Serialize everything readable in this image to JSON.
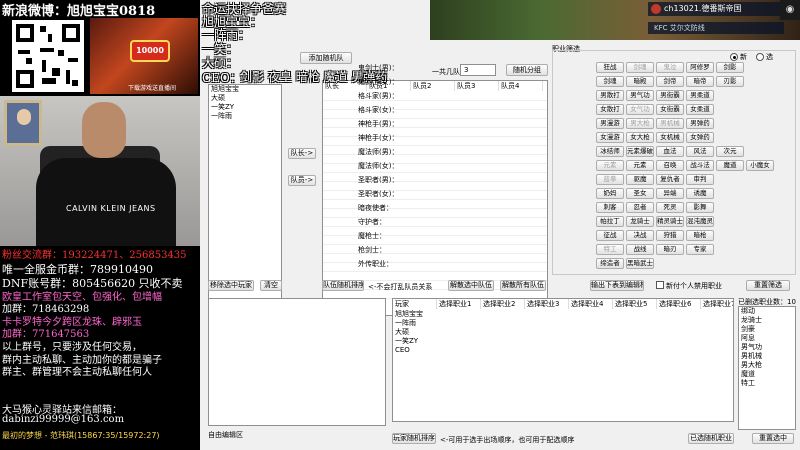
{
  "overlay_left": {
    "weibo": "新浪微博：旭旭宝宝0818",
    "promo_badge": "10000",
    "promo_caption": "下载游戏送直播间",
    "shirt_text": "CALVIN KLEIN JEANS",
    "group_line": "粉丝交流群：193224471、256853435",
    "gold_line": "唯一全服金币群：789910490",
    "dnf_line": "DNF账号群：805456620 只收不卖",
    "eu_line": "欧皇工作室包天空、包强化、包增幅",
    "eu_join": "加群：718463298",
    "card_line": "卡卡罗特今夕跨区龙珠、辟邪玉",
    "card_join": "加群：771647563",
    "warn1": "以上群号，只要涉及任何交易，",
    "warn2": "群内主动私聊、主动加你的都是骗子",
    "warn3": "群主、群管理不会主动私聊任何人",
    "email_label": "大马猴心灵驿站来信邮箱：",
    "email": "dabinzi99999@163.com",
    "stream_status": "最初的梦想 - 范玮琪(15867:35/15972:27)"
  },
  "overlay_titles": {
    "line1": "命运抉择争爸赛",
    "line2": "旭旭宝宝：",
    "line3": "一阵雨：",
    "line4": "一笑：",
    "line5": "大硕：",
    "ceo_label": "CEO：",
    "ceo_classes": "剑影 夜皇  暗枪  魔道  男弹药"
  },
  "game": {
    "player": "ch13021.德番斯帝国",
    "label": "KFC  艾尔文防线",
    "hud": "◉"
  },
  "app": {
    "add_team_button": "添加随机队",
    "team_count_label": "一共几队",
    "team_count_value": "3",
    "random_group_button": "随机分组",
    "players_list": [
      "旭旭宝宝",
      "大硕",
      "一笑ZY",
      "一阵雨"
    ],
    "team_columns": [
      "队长",
      "队员1",
      "队员2",
      "队员3",
      "队员4"
    ],
    "to_captain_button": "队长->",
    "to_member_button": "队员->",
    "move_random_button": "移除选中玩家",
    "clear_button": "清空",
    "team_random_sort_button": "队伍随机排序",
    "team_hint": "<-不会打乱队员关系",
    "dissolve_team_button": "解散选中队伍",
    "dissolve_all_button": "解散所有队伍",
    "job_filter_title": "职业筛选",
    "radio_new": "新",
    "radio_old": "选",
    "job_rows": [
      {
        "label": "鬼剑士(男)：",
        "jobs": [
          "狂战",
          "剑魂",
          "鬼泣",
          "阿修罗",
          "剑影"
        ],
        "disabled": [
          false,
          true,
          true,
          false,
          false
        ]
      },
      {
        "label": "鬼剑士(女)：",
        "jobs": [
          "剑魂",
          "暗殿",
          "剑帝",
          "暗帝",
          "刃影"
        ],
        "disabled": [
          false,
          false,
          false,
          false,
          false
        ]
      },
      {
        "label": "格斗家(男)：",
        "jobs": [
          "男散打",
          "男气功",
          "男街霸",
          "男柔道"
        ],
        "disabled": [
          false,
          false,
          false,
          false
        ]
      },
      {
        "label": "格斗家(女)：",
        "jobs": [
          "女散打",
          "女气功",
          "女街霸",
          "女柔道"
        ],
        "disabled": [
          false,
          true,
          false,
          false
        ]
      },
      {
        "label": "神枪手(男)：",
        "jobs": [
          "男漫游",
          "男大枪",
          "男机械",
          "男弹药"
        ],
        "disabled": [
          false,
          true,
          true,
          false
        ]
      },
      {
        "label": "神枪手(女)：",
        "jobs": [
          "女漫游",
          "女大枪",
          "女机械",
          "女弹药"
        ],
        "disabled": [
          false,
          false,
          false,
          false
        ]
      },
      {
        "label": "魔法师(男)：",
        "jobs": [
          "冰结师",
          "元素爆破",
          "血法",
          "风法",
          "次元"
        ],
        "disabled": [
          false,
          false,
          false,
          false,
          false
        ]
      },
      {
        "label": "魔法师(女)：",
        "jobs": [
          "元素",
          "元素",
          "召唤",
          "战斗法",
          "魔道",
          "小魔女"
        ],
        "disabled": [
          true,
          false,
          false,
          false,
          false,
          false
        ]
      },
      {
        "label": "圣职者(男)：",
        "jobs": [
          "蓝拳",
          "驱魔",
          "复仇者",
          "审判"
        ],
        "disabled": [
          true,
          false,
          false,
          false
        ]
      },
      {
        "label": "圣职者(女)：",
        "jobs": [
          "奶妈",
          "圣女",
          "异端",
          "诱魔"
        ],
        "disabled": [
          false,
          false,
          false,
          false
        ]
      },
      {
        "label": "暗夜使者：",
        "jobs": [
          "刺客",
          "忍者",
          "死灵",
          "影舞"
        ],
        "disabled": [
          false,
          false,
          false,
          false
        ]
      },
      {
        "label": "守护者：",
        "jobs": [
          "帕拉丁",
          "龙骑士",
          "精灵骑士",
          "混沌魔灵"
        ],
        "disabled": [
          false,
          false,
          false,
          false
        ]
      },
      {
        "label": "魔枪士：",
        "jobs": [
          "征战",
          "决战",
          "狩猎",
          "暗枪"
        ],
        "disabled": [
          false,
          false,
          false,
          false
        ]
      },
      {
        "label": "枪剑士：",
        "jobs": [
          "特工",
          "战线",
          "暗刃",
          "专家"
        ],
        "disabled": [
          true,
          false,
          false,
          false
        ]
      },
      {
        "label": "外传职业：",
        "jobs": [
          "缔造者",
          "黑暗武士"
        ],
        "disabled": [
          false,
          false
        ]
      }
    ],
    "output_button": "输出下表到编辑框",
    "checkbox_label": "新付个人禁用职业",
    "reset_button": "重置筛选",
    "player_table_columns": [
      "玩家",
      "选择职业1",
      "选择职业2",
      "选择职业3",
      "选择职业4",
      "选择职业5",
      "选择职业6",
      "选择职业7"
    ],
    "player_table_rows": [
      "旭旭宝宝",
      "一阵雨",
      "大硕",
      "一笑ZY",
      "CEO"
    ],
    "selected_jobs_title": "已删选职业数：10",
    "selected_jobs": [
      "绑动",
      "龙骑士",
      "剑豪",
      "阿息",
      "男气功",
      "男机械",
      "男大枪",
      "魔道",
      "特工"
    ],
    "edit_box_label": "自由编辑区",
    "player_sort_button": "玩家随机排序",
    "player_sort_hint": "<-可用于选手出场顺序，也可用于配选顺序",
    "selected_random_button": "已选随机职业",
    "reset_select_button": "重置选中"
  }
}
